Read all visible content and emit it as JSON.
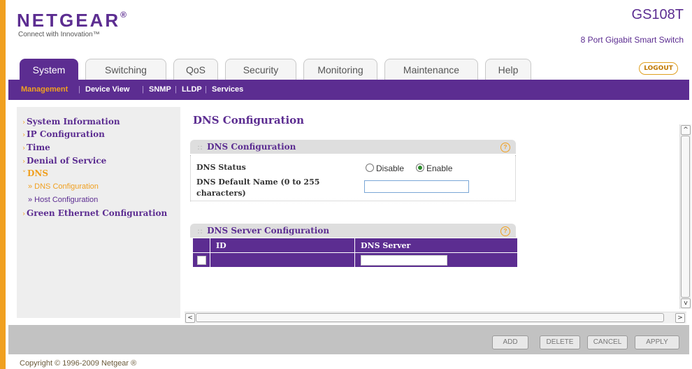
{
  "header": {
    "brand": "NETGEAR",
    "brand_mark": "®",
    "tagline": "Connect with Innovation™",
    "model": "GS108T",
    "subtitle": "8 Port Gigabit Smart Switch",
    "logout_label": "LOGOUT"
  },
  "tabs": [
    {
      "label": "System",
      "active": true
    },
    {
      "label": "Switching"
    },
    {
      "label": "QoS"
    },
    {
      "label": "Security"
    },
    {
      "label": "Monitoring"
    },
    {
      "label": "Maintenance"
    },
    {
      "label": "Help"
    }
  ],
  "subnav": [
    {
      "label": "Management",
      "active": true
    },
    {
      "label": "Device View"
    },
    {
      "label": "SNMP"
    },
    {
      "label": "LLDP"
    },
    {
      "label": "Services"
    }
  ],
  "subnav_separator": "|",
  "sidebar": {
    "items": [
      {
        "label": "System Information"
      },
      {
        "label": "IP Configuration"
      },
      {
        "label": "Time"
      },
      {
        "label": "Denial of Service"
      },
      {
        "label": "DNS",
        "open": true
      },
      {
        "label": "» DNS Configuration",
        "active": true
      },
      {
        "label": "» Host Configuration"
      },
      {
        "label": "Green Ethernet Configuration"
      }
    ],
    "closed_arrow": "›",
    "open_arrow": "˅"
  },
  "page": {
    "title": "DNS Configuration",
    "help_icon": "?",
    "panel1": {
      "title": "DNS Configuration",
      "dns_status_label": "DNS Status",
      "disable_label": "Disable",
      "enable_label": "Enable",
      "selected": "Enable",
      "default_name_label": "DNS Default Name (0 to 255 characters)",
      "default_name_value": ""
    },
    "panel2": {
      "title": "DNS Server Configuration",
      "columns": [
        "",
        "ID",
        "DNS Server"
      ],
      "dns_server_value": ""
    }
  },
  "scroll_icons": {
    "up": "^",
    "down": "v",
    "left": "<",
    "right": ">"
  },
  "buttons": {
    "add": "ADD",
    "delete": "DELETE",
    "cancel": "CANCEL",
    "apply": "APPLY"
  },
  "footer": {
    "copyright": "Copyright © 1996-2009 Netgear ®"
  },
  "colors": {
    "brand_purple": "#5c2d91",
    "accent_orange": "#f0a020"
  }
}
